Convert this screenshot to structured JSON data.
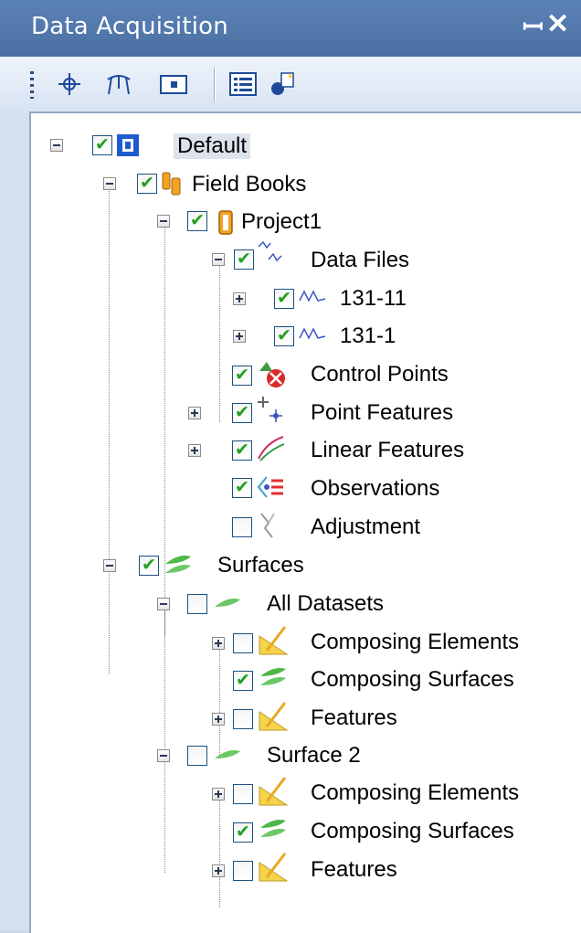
{
  "window": {
    "title": "Data Acquisition",
    "pin_icon": "pin-icon",
    "close_icon": "close-icon"
  },
  "toolbar": {
    "buttons": [
      "crosshair-icon",
      "survey-tool-icon",
      "window-tool-icon",
      "list-icon",
      "add-node-icon"
    ]
  },
  "tree": {
    "root": {
      "label": "Default",
      "checked": true,
      "icon": "default-icon"
    },
    "field_books": {
      "label": "Field Books",
      "checked": true,
      "icon": "field-books-icon"
    },
    "project1": {
      "label": "Project1",
      "checked": true,
      "icon": "project-icon"
    },
    "data_files": {
      "label": "Data Files",
      "checked": true,
      "icon": "data-files-icon"
    },
    "file1": {
      "label": "131-11",
      "checked": true,
      "icon": "data-file-icon"
    },
    "file2": {
      "label": "131-1",
      "checked": true,
      "icon": "data-file-icon"
    },
    "control_points": {
      "label": "Control Points",
      "checked": true,
      "icon": "control-points-icon"
    },
    "point_features": {
      "label": "Point Features",
      "checked": true,
      "icon": "point-features-icon"
    },
    "linear_features": {
      "label": "Linear Features",
      "checked": true,
      "icon": "linear-features-icon"
    },
    "observations": {
      "label": "Observations",
      "checked": true,
      "icon": "observations-icon"
    },
    "adjustment": {
      "label": "Adjustment",
      "checked": false,
      "icon": "adjustment-icon"
    },
    "surfaces": {
      "label": "Surfaces",
      "checked": true,
      "icon": "surfaces-icon"
    },
    "all_datasets": {
      "label": "All Datasets",
      "checked": false,
      "icon": "surface-icon"
    },
    "ad_composing_elements": {
      "label": "Composing Elements",
      "checked": false,
      "icon": "composing-elements-icon"
    },
    "ad_composing_surfaces": {
      "label": "Composing Surfaces",
      "checked": true,
      "icon": "composing-surfaces-icon"
    },
    "ad_features": {
      "label": "Features",
      "checked": false,
      "icon": "features-icon"
    },
    "surface2": {
      "label": "Surface 2",
      "checked": false,
      "icon": "surface-icon"
    },
    "s2_composing_elements": {
      "label": "Composing Elements",
      "checked": false,
      "icon": "composing-elements-icon"
    },
    "s2_composing_surfaces": {
      "label": "Composing Surfaces",
      "checked": true,
      "icon": "composing-surfaces-icon"
    },
    "s2_features": {
      "label": "Features",
      "checked": false,
      "icon": "features-icon"
    }
  }
}
